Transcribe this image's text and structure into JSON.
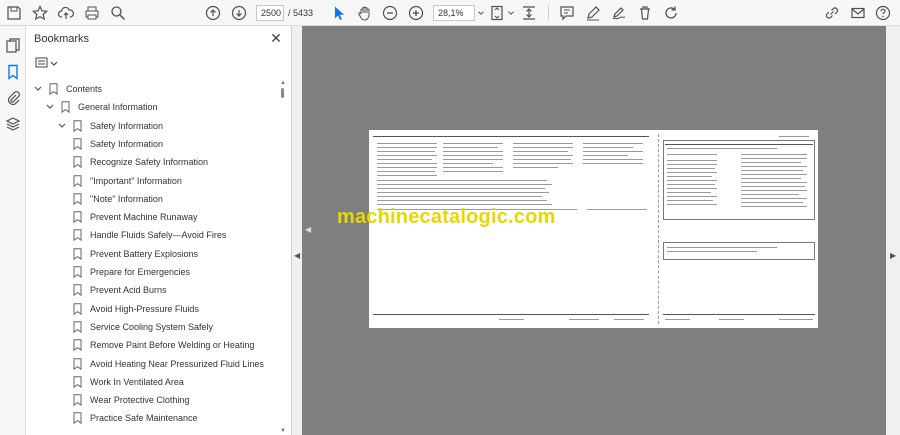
{
  "toolbar": {
    "page_current": "2500",
    "page_total": "/  5433",
    "zoom": "28,1%"
  },
  "panel": {
    "title": "Bookmarks"
  },
  "bookmarks": [
    {
      "label": "Contents",
      "level": 0,
      "expanded": true,
      "has_children": true
    },
    {
      "label": "General Information",
      "level": 1,
      "expanded": true,
      "has_children": true
    },
    {
      "label": "Safety Information",
      "level": 2,
      "expanded": true,
      "has_children": true
    },
    {
      "label": "Safety Information",
      "level": 3,
      "has_children": false
    },
    {
      "label": "Recognize Safety Information",
      "level": 3,
      "has_children": false
    },
    {
      "label": "\"Important\" Information",
      "level": 3,
      "has_children": false
    },
    {
      "label": "\"Note\" Information",
      "level": 3,
      "has_children": false
    },
    {
      "label": "Prevent Machine Runaway",
      "level": 3,
      "has_children": false
    },
    {
      "label": "Handle Fluids Safely—Avoid Fires",
      "level": 3,
      "has_children": false
    },
    {
      "label": "Prevent Battery Explosions",
      "level": 3,
      "has_children": false
    },
    {
      "label": "Prepare for Emergencies",
      "level": 3,
      "has_children": false
    },
    {
      "label": "Prevent Acid Burns",
      "level": 3,
      "has_children": false
    },
    {
      "label": "Avoid High-Pressure Fluids",
      "level": 3,
      "has_children": false
    },
    {
      "label": "Service Cooling System Safely",
      "level": 3,
      "has_children": false
    },
    {
      "label": "Remove Paint Before Welding or Heating",
      "level": 3,
      "has_children": false
    },
    {
      "label": "Avoid Heating Near Pressurized Fluid Lines",
      "level": 3,
      "has_children": false
    },
    {
      "label": "Work In Ventilated Area",
      "level": 3,
      "has_children": false
    },
    {
      "label": "Wear Protective Clothing",
      "level": 3,
      "has_children": false
    },
    {
      "label": "Practice Safe Maintenance",
      "level": 3,
      "has_children": false
    }
  ],
  "document": {
    "watermark": "machinecatalogic.com",
    "right_group": "Group 9215",
    "right_heading": "ECU Control Unit (Electronic Hitch Control)"
  },
  "colors": {
    "accent": "#1473e6",
    "doc_background": "#7f7f7f",
    "watermark": "#e6d800"
  }
}
